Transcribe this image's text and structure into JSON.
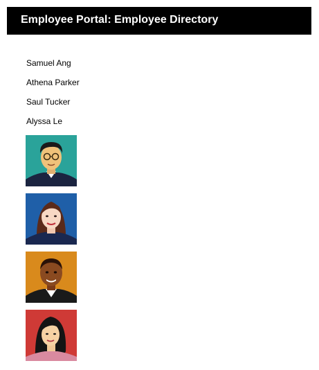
{
  "header": {
    "title": "Employee Portal: Employee Directory"
  },
  "employees": [
    {
      "name": "Samuel Ang",
      "bg": "#2aa39a"
    },
    {
      "name": "Athena Parker",
      "bg": "#1f5fa8"
    },
    {
      "name": "Saul Tucker",
      "bg": "#d98a1c"
    },
    {
      "name": "Alyssa Le",
      "bg": "#cf3a36"
    }
  ],
  "colors": {
    "header_bg": "#000000",
    "header_text": "#ffffff",
    "body_text": "#000000"
  }
}
